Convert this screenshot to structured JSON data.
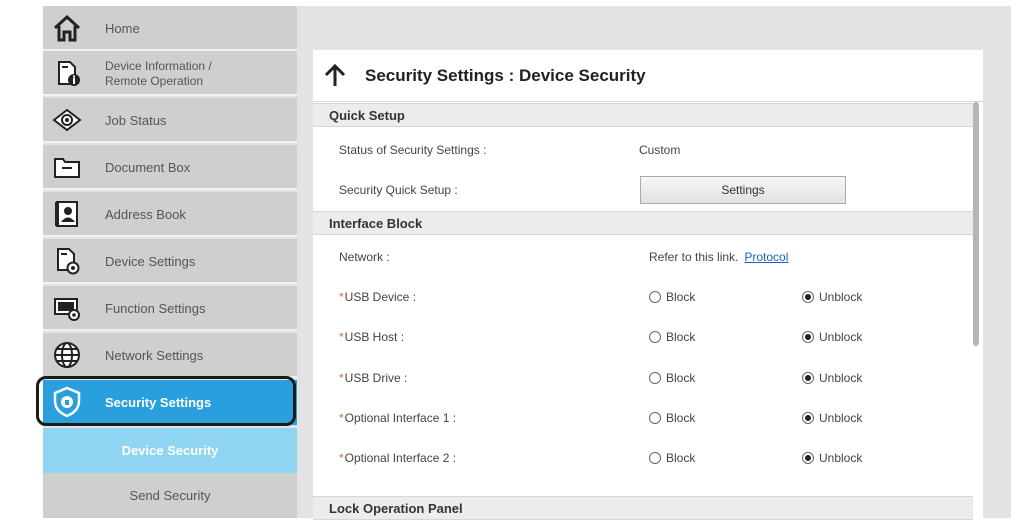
{
  "sidebar": {
    "items": [
      {
        "label": "Home",
        "icon": "home-icon"
      },
      {
        "label": "Device Information / Remote Operation",
        "line1": "Device Information /",
        "line2": "Remote Operation",
        "icon": "device-info-icon"
      },
      {
        "label": "Job Status",
        "icon": "eye-icon"
      },
      {
        "label": "Document Box",
        "icon": "folder-icon"
      },
      {
        "label": "Address Book",
        "icon": "address-book-icon"
      },
      {
        "label": "Device Settings",
        "icon": "device-settings-icon"
      },
      {
        "label": "Function Settings",
        "icon": "function-settings-icon"
      },
      {
        "label": "Network Settings",
        "icon": "globe-icon"
      },
      {
        "label": "Security Settings",
        "icon": "shield-icon"
      }
    ],
    "sub_items": [
      {
        "label": "Device Security"
      },
      {
        "label": "Send Security"
      }
    ]
  },
  "panel": {
    "title": "Security Settings : Device Security",
    "quick_setup": {
      "header": "Quick Setup",
      "status_label": "Status of Security Settings :",
      "status_value": "Custom",
      "quick_setup_label": "Security Quick Setup :",
      "settings_button": "Settings"
    },
    "interface_block": {
      "header": "Interface Block",
      "network_label": "Network :",
      "network_value": "Refer to this link.",
      "network_link": "Protocol",
      "block_label": "Block",
      "unblock_label": "Unblock",
      "rows": [
        {
          "label": "USB Device :",
          "selected": "Unblock"
        },
        {
          "label": "USB Host :",
          "selected": "Unblock"
        },
        {
          "label": "USB Drive :",
          "selected": "Unblock"
        },
        {
          "label": "Optional Interface 1 :",
          "selected": "Unblock"
        },
        {
          "label": "Optional Interface 2 :",
          "selected": "Unblock"
        }
      ]
    },
    "lock_panel": {
      "header": "Lock Operation Panel"
    }
  },
  "colors": {
    "active": "#2a9fde",
    "selected_sub": "#8fd4f2",
    "link": "#1e5ec8",
    "required_mark": "#e06a2a"
  }
}
